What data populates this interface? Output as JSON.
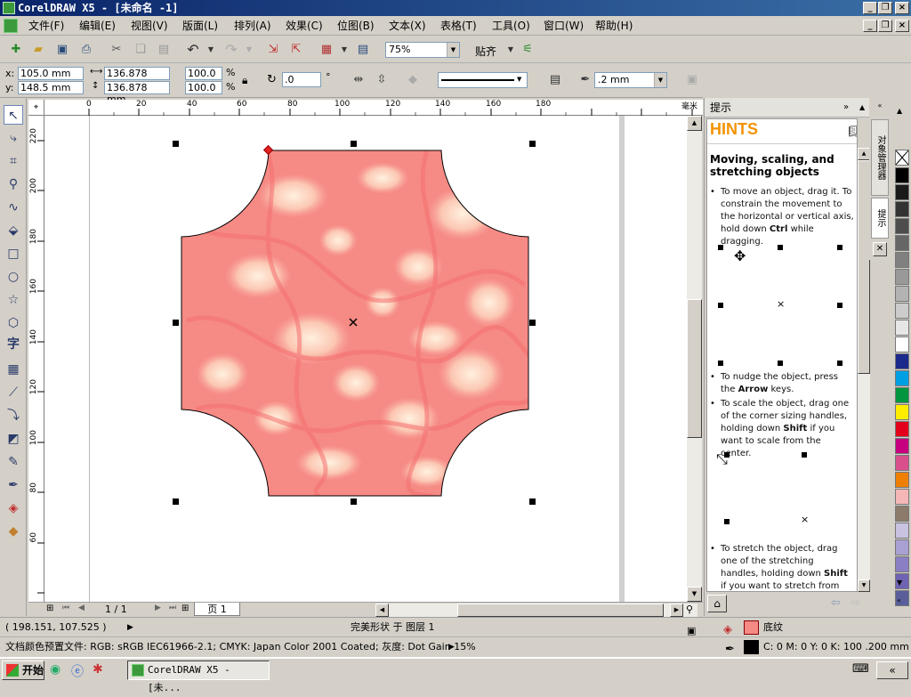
{
  "window": {
    "title": "CorelDRAW X5 - [未命名 -1]"
  },
  "menu": [
    "文件(F)",
    "编辑(E)",
    "视图(V)",
    "版面(L)",
    "排列(A)",
    "效果(C)",
    "位图(B)",
    "文本(X)",
    "表格(T)",
    "工具(O)",
    "窗口(W)",
    "帮助(H)"
  ],
  "toolbar": {
    "zoom": "75%",
    "snap_label": "贴齐"
  },
  "propbar": {
    "x_label": "x:",
    "x_value": "105.0 mm",
    "y_label": "y:",
    "y_value": "148.5 mm",
    "w_value": "136.878 mm",
    "h_value": "136.878 mm",
    "scale_x": "100.0",
    "scale_y": "100.0",
    "pct": "%",
    "rotation": ".0",
    "degree": "°",
    "outline_width": ".2 mm"
  },
  "ruler": {
    "h_ticks": [
      "0",
      "20",
      "40",
      "60",
      "80",
      "100",
      "120",
      "140",
      "160",
      "180"
    ],
    "h_unit": "毫米",
    "v_ticks": [
      "220",
      "200",
      "180",
      "160",
      "140",
      "120",
      "100",
      "80",
      "60"
    ]
  },
  "page_nav": {
    "counter": "1 / 1",
    "tab": "页 1"
  },
  "hints": {
    "panel_title": "提示",
    "header": "HINTS",
    "heading": "Moving, scaling, and stretching objects",
    "p1_a": "To move an object, drag it. To constrain the movement to the horizontal or vertical axis, hold down ",
    "p1_b": "Ctrl",
    "p1_c": " while dragging.",
    "p2_a": "To nudge the object, press the ",
    "p2_b": "Arrow",
    "p2_c": " keys.",
    "p3_a": "To scale the object, drag one of the corner sizing handles, holding down ",
    "p3_b": "Shift",
    "p3_c": " if you want to scale from the center.",
    "p4_a": "To stretch the object, drag one of the stretching handles, holding down ",
    "p4_b": "Shift",
    "p4_c": " if you want to stretch from the",
    "tab_object_manager": "对象管理器",
    "tab_hints": "提示"
  },
  "status": {
    "coords": "( 198.151, 107.525 )",
    "object_info": "完美形状 于 图层 1",
    "fill_name": "底纹",
    "color_profile": "文档颜色预置文件: RGB: sRGB IEC61966-2.1; CMYK: Japan Color 2001 Coated; 灰度: Dot Gain 15%",
    "outline_info": "C: 0 M: 0 Y: 0 K: 100  .200 mm"
  },
  "taskbar": {
    "start": "开始",
    "task": "CorelDRAW X5 - [未..."
  },
  "palette": [
    "#ffffff",
    "#000000",
    "#1a1a1a",
    "#333333",
    "#4d4d4d",
    "#666666",
    "#808080",
    "#999999",
    "#b3b3b3",
    "#cccccc",
    "#e6e6e6",
    "#ffffff",
    "#1c2a8c",
    "#009fe3",
    "#00963f",
    "#ffed00",
    "#e2001a",
    "#c6007e",
    "#d94f8c",
    "#ee7f00",
    "#f4b6b6",
    "#8c7b6b",
    "#c9c2e0",
    "#a9a1d3",
    "#8a7fc4",
    "#6f63b4",
    "#5a5f9c"
  ],
  "colors": {
    "title_bar": "#0a246a",
    "hints_orange": "#f39200",
    "fill_pink": "#f68a85"
  }
}
